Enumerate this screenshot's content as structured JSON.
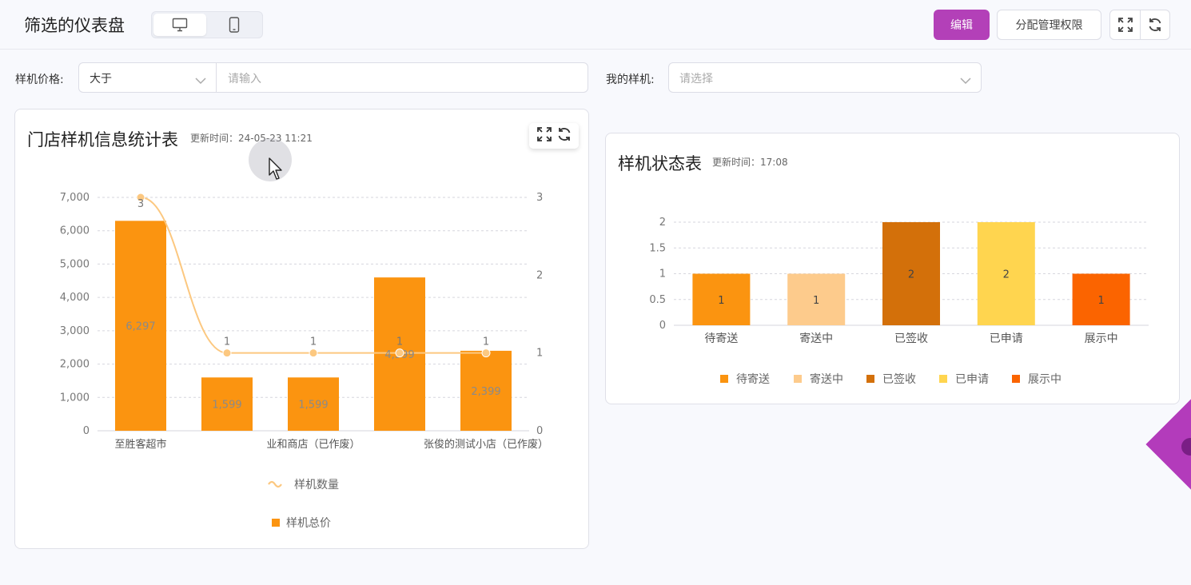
{
  "header": {
    "title": "筛选的仪表盘",
    "edit_label": "编辑",
    "permission_label": "分配管理权限"
  },
  "filters": {
    "price_label": "样机价格:",
    "price_operator": "大于",
    "price_placeholder": "请输入",
    "my_device_label": "我的样机:",
    "my_device_placeholder": "请选择"
  },
  "card_left": {
    "title": "门店样机信息统计表",
    "update_time": "更新时间：24-05-23 11:21"
  },
  "card_right": {
    "title": "样机状态表",
    "update_time": "更新时间：17:08"
  },
  "colors": {
    "accent": "#b340b8",
    "bar_orange": "#fb9410",
    "line_light": "#fcc880"
  },
  "chart_data": [
    {
      "type": "bar",
      "categories": [
        "至胜客超市",
        "",
        "业和商店（已作废）",
        "",
        "张俊的测试小店（已作废）"
      ],
      "y_left_ticks": [
        "0",
        "1,000",
        "2,000",
        "3,000",
        "4,000",
        "5,000",
        "6,000",
        "7,000"
      ],
      "y_right_ticks": [
        "0",
        "1",
        "2",
        "3"
      ],
      "ylim": [
        0,
        7000
      ],
      "y2lim": [
        0,
        3
      ],
      "grid": true,
      "legend_position": "bottom",
      "series": [
        {
          "name": "样机数量",
          "type": "line",
          "axis": "right",
          "values": [
            3,
            1,
            1,
            1,
            1
          ],
          "labels": [
            "3",
            "1",
            "1",
            "1",
            "1"
          ]
        },
        {
          "name": "样机总价",
          "type": "bar",
          "axis": "left",
          "values": [
            6297,
            1599,
            1599,
            4599,
            2399
          ],
          "labels": [
            "6,297",
            "1,599",
            "1,599",
            "4,599",
            "2,399"
          ]
        }
      ]
    },
    {
      "type": "bar",
      "categories": [
        "待寄送",
        "寄送中",
        "已签收",
        "已申请",
        "展示中"
      ],
      "values": [
        1,
        1,
        2,
        2,
        1
      ],
      "labels": [
        "1",
        "1",
        "2",
        "2",
        "1"
      ],
      "colors": [
        "#fb9410",
        "#fdcb8c",
        "#d3700a",
        "#ffd54f",
        "#fb6400"
      ],
      "y_ticks": [
        "0",
        "0.5",
        "1",
        "1.5",
        "2"
      ],
      "ylim": [
        0,
        2
      ],
      "grid": true,
      "legend_position": "bottom",
      "legend": [
        "待寄送",
        "寄送中",
        "已签收",
        "已申请",
        "展示中"
      ]
    }
  ]
}
